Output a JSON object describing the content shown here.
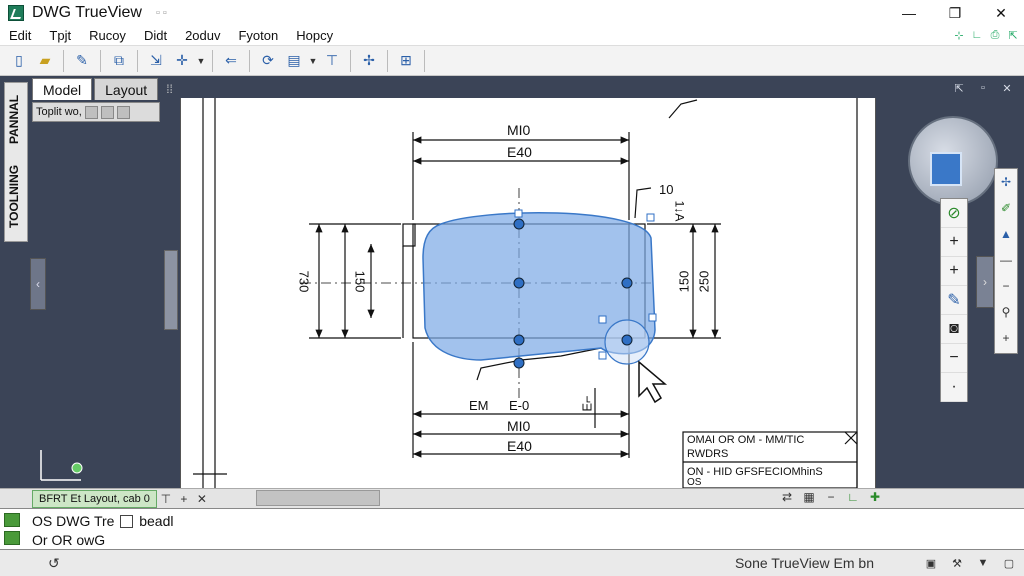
{
  "window": {
    "title": "DWG TrueView",
    "pin_glyph": "▫ ▫",
    "minimize": "—",
    "maximize": "❐",
    "close": "✕"
  },
  "menu": {
    "items": [
      "Edit",
      "Tpjt",
      "Rucoy",
      "Didt",
      "2oduv",
      "Fyoton",
      "Hopcy"
    ]
  },
  "toolbar": {
    "icons": [
      "new-doc-icon",
      "open-folder-icon",
      "erase-icon",
      "copy-icon",
      "select-icon",
      "move-icon",
      "undo-icon",
      "orbit-icon",
      "layers-icon",
      "measure-icon",
      "snap-icon",
      "grid-icon"
    ]
  },
  "left_palette": {
    "tab1": "PANNAL",
    "tab2": "TOOLNING"
  },
  "layout_tabs": {
    "model": "Model",
    "layout": "Layout",
    "more": "⁞⁞"
  },
  "viewport_strip": {
    "label": "Toplit wo,"
  },
  "drawing": {
    "dim_top1": "MI0",
    "dim_top2": "E40",
    "dim_left_outer": "730",
    "dim_left_inner": "150",
    "dim_right_inner": "150",
    "dim_right_outer": "250",
    "dim_corner": "10",
    "dim_corner_v": "1↓A",
    "dim_bottom_label_a": "EM",
    "dim_bottom_label_b": "E-0",
    "dim_bottom_label_c": "E⌐",
    "dim_bottom1": "MI0",
    "dim_bottom2": "E40",
    "title_block_l1": "OMAI OR OM - MM/TIC",
    "title_block_l2": "RWDRS",
    "title_block_l3": "ON - HID GFSFECIOMhinS",
    "title_block_l4": "OS"
  },
  "bottom_bar": {
    "layout_label": "BFRT Et Layout, cab 0"
  },
  "command": {
    "line1_a": "OS DWG Tre",
    "line1_b": "beadl",
    "line2": "Or OR owG"
  },
  "status": {
    "text": "Sone TrueView Em bn",
    "left_icon": "↺"
  },
  "colors": {
    "frame_bg": "#3b4457",
    "selection_fill": "#7aa8e6",
    "selection_stroke": "#3a78c8",
    "grip": "#2f6fc4"
  }
}
